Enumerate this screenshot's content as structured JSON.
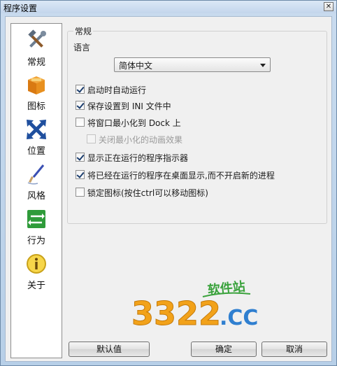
{
  "window": {
    "title": "程序设置",
    "close_glyph": "✕"
  },
  "sidebar": {
    "items": [
      {
        "label": "常规",
        "icon": "tools-icon"
      },
      {
        "label": "图标",
        "icon": "box-icon"
      },
      {
        "label": "位置",
        "icon": "arrows-icon"
      },
      {
        "label": "风格",
        "icon": "brush-icon"
      },
      {
        "label": "行为",
        "icon": "exchange-icon"
      },
      {
        "label": "关于",
        "icon": "info-icon"
      }
    ]
  },
  "general": {
    "group_title": "常规",
    "language_label": "语言",
    "language_value": "简体中文",
    "options": [
      {
        "label": "启动时自动运行",
        "checked": true
      },
      {
        "label": "保存设置到 INI 文件中",
        "checked": true
      },
      {
        "label": "将窗口最小化到 Dock 上",
        "checked": false
      },
      {
        "label": "关闭最小化的动画效果",
        "checked": false,
        "disabled": true
      },
      {
        "label": "显示正在运行的程序指示器",
        "checked": true
      },
      {
        "label": "将已经在运行的程序在桌面显示,而不开启新的进程",
        "checked": true
      },
      {
        "label": "锁定图标(按住ctrl可以移动图标)",
        "checked": false
      }
    ]
  },
  "watermark": {
    "number": "3322",
    "domain": ".CC",
    "tagline": "软件站"
  },
  "buttons": {
    "default": "默认值",
    "ok": "确定",
    "cancel": "取消"
  }
}
